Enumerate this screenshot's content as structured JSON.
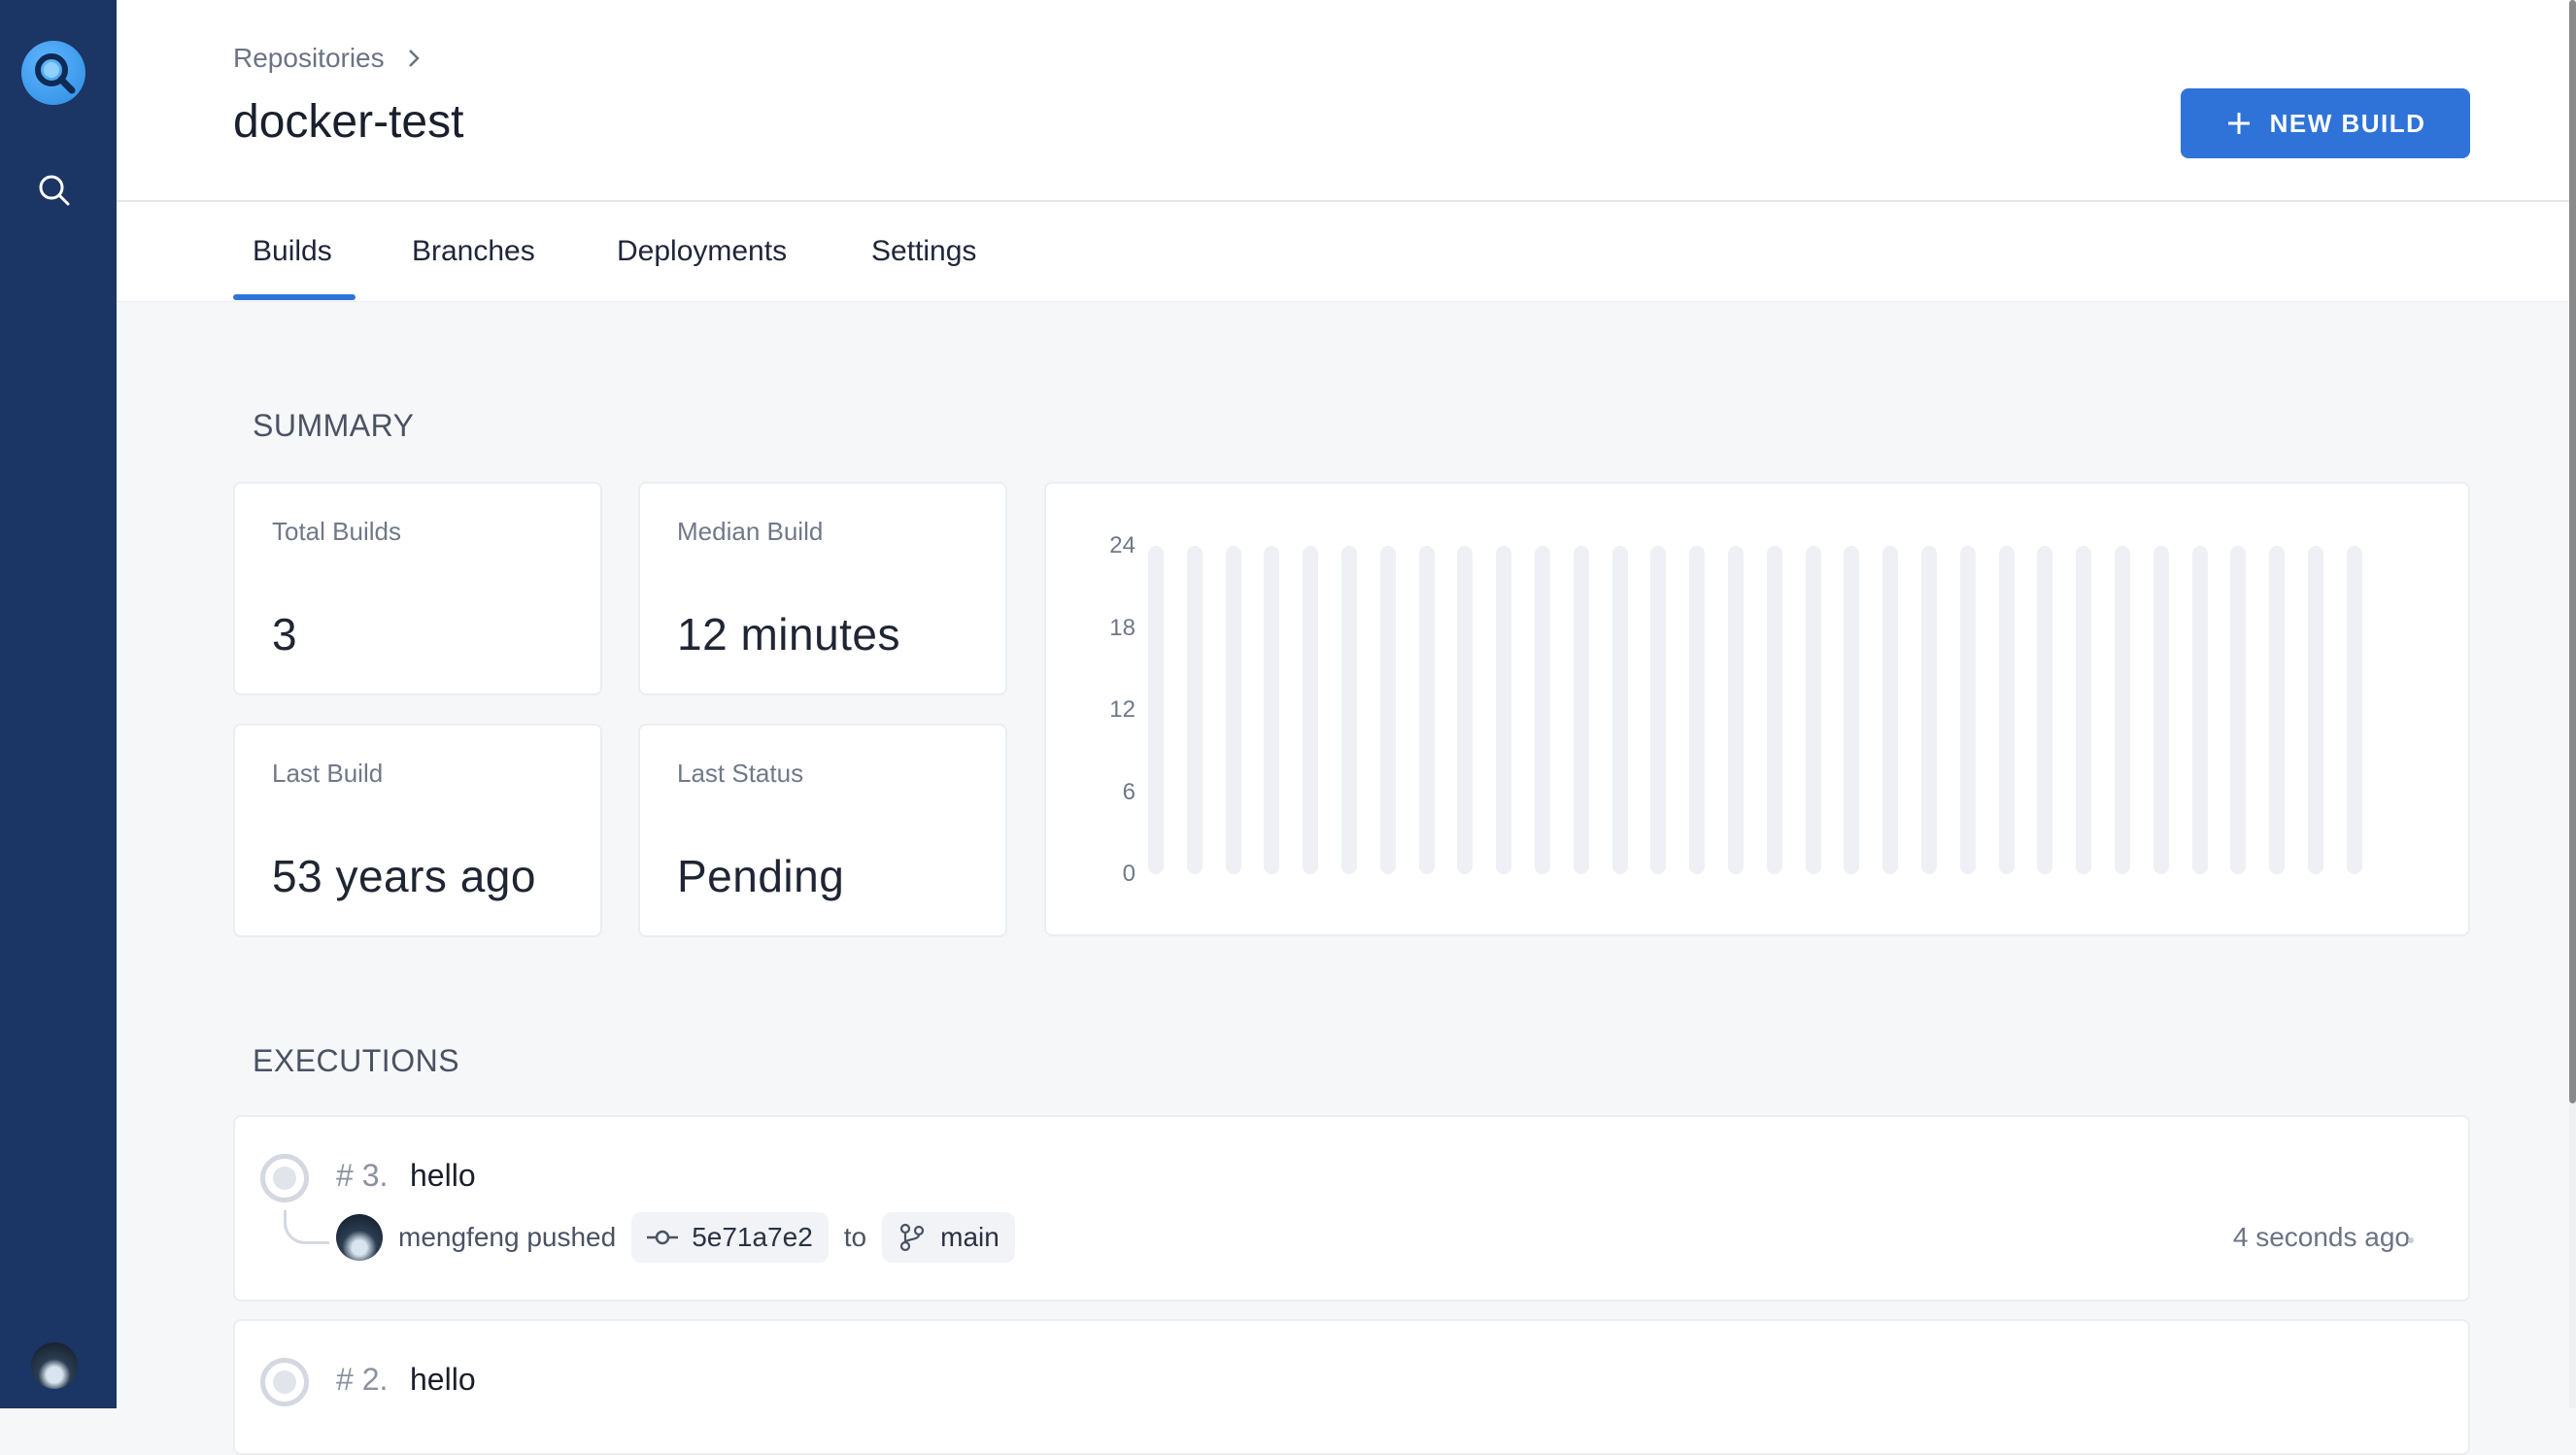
{
  "breadcrumb": {
    "parent": "Repositories"
  },
  "page": {
    "title": "docker-test"
  },
  "header": {
    "new_build_label": "NEW BUILD"
  },
  "tabs": [
    {
      "label": "Builds",
      "active": true
    },
    {
      "label": "Branches",
      "active": false
    },
    {
      "label": "Deployments",
      "active": false
    },
    {
      "label": "Settings",
      "active": false
    }
  ],
  "summary": {
    "title": "SUMMARY",
    "stats": {
      "total_builds": {
        "label": "Total Builds",
        "value": "3"
      },
      "median_build": {
        "label": "Median Build",
        "value": "12 minutes"
      },
      "last_build": {
        "label": "Last Build",
        "value": "53 years ago"
      },
      "last_status": {
        "label": "Last Status",
        "value": "Pending"
      }
    }
  },
  "chart_data": {
    "type": "bar",
    "yticks": [
      "24",
      "18",
      "12",
      "6",
      "0"
    ],
    "ylim": [
      0,
      24
    ],
    "bar_count": 32,
    "values": [
      0,
      0,
      0,
      0,
      0,
      0,
      0,
      0,
      0,
      0,
      0,
      0,
      0,
      0,
      0,
      0,
      0,
      0,
      0,
      0,
      0,
      0,
      0,
      0,
      0,
      0,
      0,
      0,
      0,
      0,
      0,
      0
    ],
    "track_color": "#eef0f6"
  },
  "executions": {
    "title": "EXECUTIONS",
    "items": [
      {
        "number": "# 3.",
        "title": "hello",
        "author": "mengfeng pushed",
        "commit": "5e71a7e2",
        "connector": "to",
        "branch": "main",
        "time": "4 seconds ago"
      },
      {
        "number": "# 2.",
        "title": "hello"
      }
    ]
  },
  "colors": {
    "sidebar": "#1b3564",
    "accent": "#2f73d9"
  }
}
